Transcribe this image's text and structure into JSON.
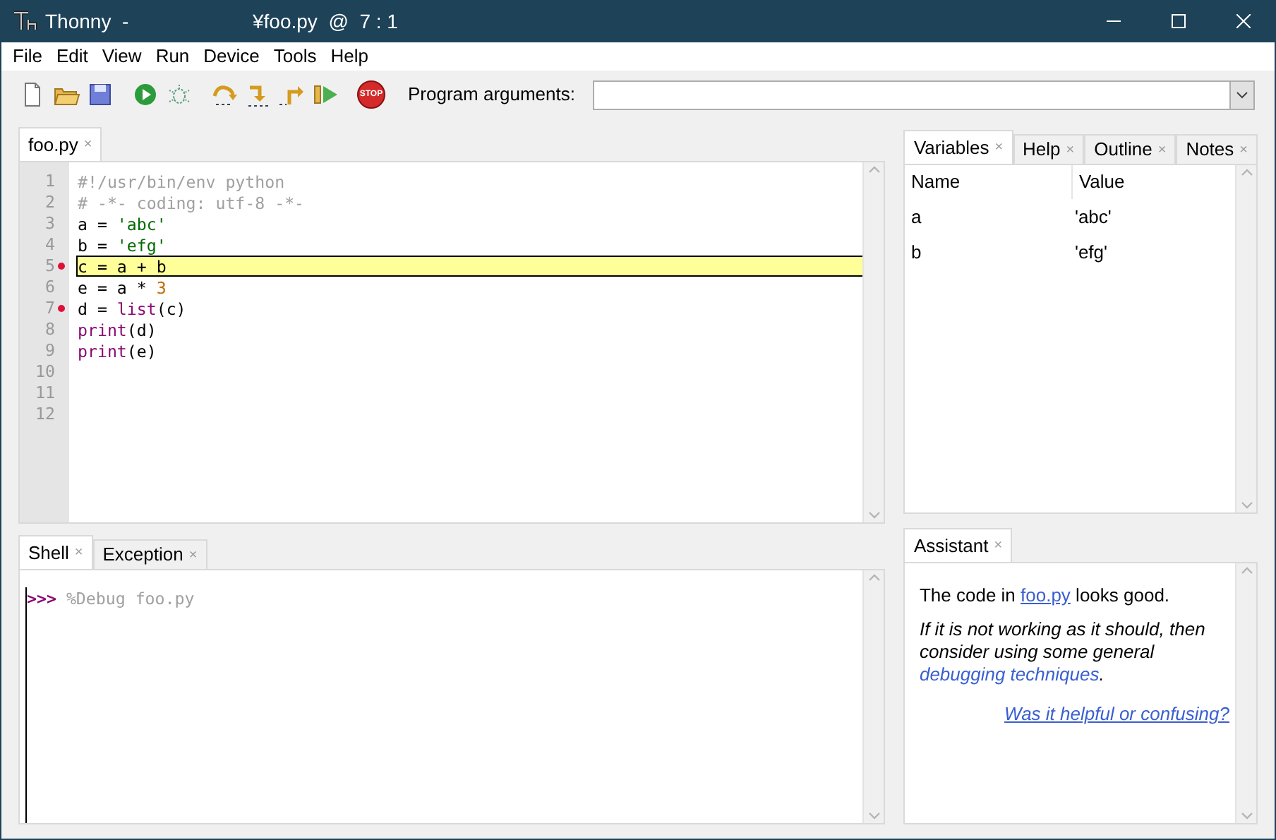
{
  "window": {
    "app_title": "Thonny  -",
    "doc_title": "¥foo.py  @  7 : 1"
  },
  "menu": [
    "File",
    "Edit",
    "View",
    "Run",
    "Device",
    "Tools",
    "Help"
  ],
  "toolbar": {
    "tools": [
      {
        "kind": "new"
      },
      {
        "kind": "open"
      },
      {
        "kind": "save"
      },
      {
        "kind": "run"
      },
      {
        "kind": "debug"
      },
      {
        "kind": "step_over"
      },
      {
        "kind": "step_into"
      },
      {
        "kind": "step_out"
      },
      {
        "kind": "resume"
      },
      {
        "kind": "stop",
        "label": "STOP"
      }
    ],
    "args_label": "Program arguments:"
  },
  "editor": {
    "tabs": [
      {
        "label": "foo.py",
        "close": "×",
        "selected": true
      }
    ],
    "lines": [
      {
        "number": "1",
        "breakpoint": false,
        "current": false,
        "tokens": [
          {
            "text": "#!/usr/bin/env python",
            "kind": "comment"
          }
        ]
      },
      {
        "number": "2",
        "breakpoint": false,
        "current": false,
        "tokens": [
          {
            "text": "# -*- coding: utf-8 -*-",
            "kind": "comment"
          }
        ]
      },
      {
        "number": "3",
        "breakpoint": false,
        "current": false,
        "tokens": [
          {
            "text": "a = ",
            "kind": "plain"
          },
          {
            "text": "'abc'",
            "kind": "string"
          }
        ]
      },
      {
        "number": "4",
        "breakpoint": false,
        "current": false,
        "tokens": [
          {
            "text": "b = ",
            "kind": "plain"
          },
          {
            "text": "'efg'",
            "kind": "string"
          }
        ]
      },
      {
        "number": "5",
        "breakpoint": true,
        "current": true,
        "tokens": [
          {
            "text": "c = a + b",
            "kind": "plain"
          }
        ]
      },
      {
        "number": "6",
        "breakpoint": false,
        "current": false,
        "tokens": [
          {
            "text": "e = a * ",
            "kind": "plain"
          },
          {
            "text": "3",
            "kind": "number"
          }
        ]
      },
      {
        "number": "7",
        "breakpoint": true,
        "current": false,
        "tokens": [
          {
            "text": "d = ",
            "kind": "plain"
          },
          {
            "text": "list",
            "kind": "builtin"
          },
          {
            "text": "(c)",
            "kind": "plain"
          }
        ]
      },
      {
        "number": "8",
        "breakpoint": false,
        "current": false,
        "tokens": [
          {
            "text": "print",
            "kind": "builtin"
          },
          {
            "text": "(d)",
            "kind": "plain"
          }
        ]
      },
      {
        "number": "9",
        "breakpoint": false,
        "current": false,
        "tokens": [
          {
            "text": "print",
            "kind": "builtin"
          },
          {
            "text": "(e)",
            "kind": "plain"
          }
        ]
      },
      {
        "number": "10",
        "breakpoint": false,
        "current": false
      },
      {
        "number": "11",
        "breakpoint": false,
        "current": false
      },
      {
        "number": "12",
        "breakpoint": false,
        "current": false
      }
    ]
  },
  "shell": {
    "tabs": [
      {
        "label": "Shell",
        "close": "×",
        "selected": true
      },
      {
        "label": "Exception",
        "close": "×",
        "selected": false
      }
    ],
    "prompt": ">>>",
    "command": "%Debug foo.py"
  },
  "variables": {
    "tabs": [
      {
        "label": "Variables",
        "close": "×",
        "selected": true
      },
      {
        "label": "Help",
        "close": "×",
        "selected": false
      },
      {
        "label": "Outline",
        "close": "×",
        "selected": false
      },
      {
        "label": "Notes",
        "close": "×",
        "selected": false
      }
    ],
    "columns": [
      "Name",
      "Value"
    ],
    "rows": [
      {
        "name": "a",
        "value": "'abc'"
      },
      {
        "name": "b",
        "value": "'efg'"
      }
    ]
  },
  "assistant": {
    "tabs": [
      {
        "label": "Assistant",
        "close": "×",
        "selected": true
      }
    ],
    "message": {
      "before": "The code in ",
      "link": "foo.py",
      "after": " looks good."
    },
    "advice": {
      "before": "If it is not working as it should, then consider using some general ",
      "link": "debugging techniques",
      "after": "."
    },
    "feedback_link": "Was it helpful or confusing?"
  }
}
